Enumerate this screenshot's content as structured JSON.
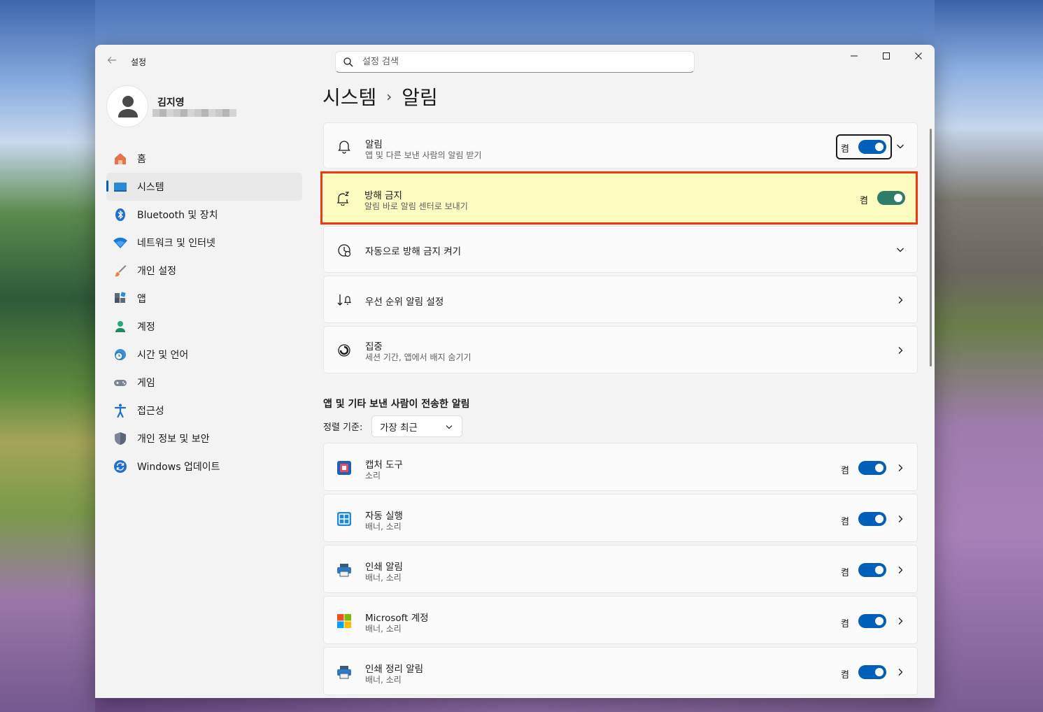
{
  "window": {
    "app_title": "설정"
  },
  "search": {
    "placeholder": "설정 검색"
  },
  "profile": {
    "name": "김지영"
  },
  "sidebar": {
    "items": [
      {
        "label": "홈",
        "icon": "home-icon"
      },
      {
        "label": "시스템",
        "icon": "system-icon",
        "active": true
      },
      {
        "label": "Bluetooth 및 장치",
        "icon": "bluetooth-icon"
      },
      {
        "label": "네트워크 및 인터넷",
        "icon": "wifi-icon"
      },
      {
        "label": "개인 설정",
        "icon": "brush-icon"
      },
      {
        "label": "앱",
        "icon": "apps-icon"
      },
      {
        "label": "계정",
        "icon": "account-icon"
      },
      {
        "label": "시간 및 언어",
        "icon": "clock-globe-icon"
      },
      {
        "label": "게임",
        "icon": "gamepad-icon"
      },
      {
        "label": "접근성",
        "icon": "accessibility-icon"
      },
      {
        "label": "개인 정보 및 보안",
        "icon": "shield-icon"
      },
      {
        "label": "Windows 업데이트",
        "icon": "update-icon"
      }
    ]
  },
  "breadcrumb": {
    "parent": "시스템",
    "separator": "›",
    "current": "알림"
  },
  "settings": {
    "notifications": {
      "title": "알림",
      "subtitle": "앱 및 다른 보낸 사람의 알림 받기",
      "state": "켬"
    },
    "dnd": {
      "title": "방해 금지",
      "subtitle": "알림 바로 알림 센터로 보내기",
      "state": "켬"
    },
    "auto_dnd": {
      "title": "자동으로 방해 금지 켜기"
    },
    "priority": {
      "title": "우선 순위 알림 설정"
    },
    "focus": {
      "title": "집중",
      "subtitle": "세션 기간, 앱에서 배지 숨기기"
    }
  },
  "apps_section": {
    "title": "앱 및 기타 보낸 사람이 전송한 알림",
    "sort_label": "정렬 기준:",
    "sort_value": "가장 최근",
    "apps": [
      {
        "name": "캡처 도구",
        "detail": "소리",
        "state": "켬",
        "icon": "snipping-tool-icon"
      },
      {
        "name": "자동 실행",
        "detail": "배너, 소리",
        "state": "켬",
        "icon": "autoplay-icon"
      },
      {
        "name": "인쇄 알림",
        "detail": "배너, 소리",
        "state": "켬",
        "icon": "printer-icon"
      },
      {
        "name": "Microsoft 계정",
        "detail": "배너, 소리",
        "state": "켬",
        "icon": "microsoft-logo-icon"
      },
      {
        "name": "인쇄 정리 알림",
        "detail": "배너, 소리",
        "state": "켬",
        "icon": "printer-icon"
      }
    ]
  },
  "colors": {
    "accent": "#005fb8",
    "dnd_highlight": "#fcfcc0",
    "annotation_border": "#ee3a0c",
    "dnd_toggle": "#2d7d6a"
  }
}
